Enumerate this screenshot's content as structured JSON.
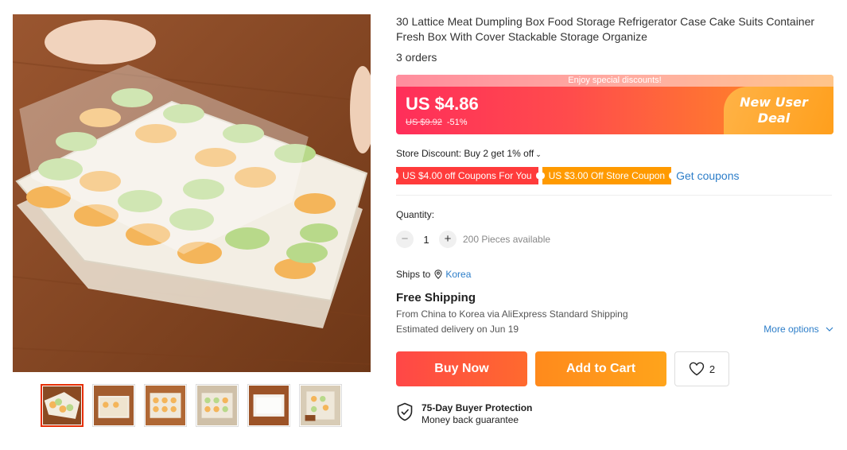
{
  "product": {
    "title": "30 Lattice Meat Dumpling Box Food Storage Refrigerator Case Cake Suits Container Fresh Box With Cover Stackable Storage Organize",
    "orders": "3 orders"
  },
  "price": {
    "banner_text": "Enjoy special discounts!",
    "current": "US $4.86",
    "original": "US $9.92",
    "discount": "-51%",
    "deal_label": "New User Deal"
  },
  "store_discount": {
    "text": "Store Discount: Buy 2 get 1% off",
    "chevron": "⌄"
  },
  "coupons": {
    "coupon1": "US $4.00 off Coupons For You",
    "coupon2": "US $3.00 Off Store Coupon",
    "get_coupons": "Get coupons"
  },
  "quantity": {
    "label": "Quantity:",
    "minus": "−",
    "value": "1",
    "plus": "+",
    "available": "200 Pieces available"
  },
  "shipping": {
    "ships_to_label": "Ships to",
    "country": "Korea",
    "free_shipping": "Free Shipping",
    "from_text": "From China to",
    "to_country": "Korea",
    "via_text": "via AliExpress Standard Shipping",
    "estimated": "Estimated delivery on Jun 19",
    "more_options": "More options"
  },
  "actions": {
    "buy_now": "Buy Now",
    "add_to_cart": "Add to Cart",
    "wishlist_count": "2"
  },
  "protection": {
    "title": "75-Day Buyer Protection",
    "subtitle": "Money back guarantee"
  },
  "colors": {
    "accent_red": "#ff4747",
    "accent_orange": "#ffa41b",
    "link_blue": "#2d7ec9"
  },
  "icons": [
    "location-pin-icon",
    "heart-icon",
    "shield-check-icon",
    "chevron-down-icon"
  ]
}
